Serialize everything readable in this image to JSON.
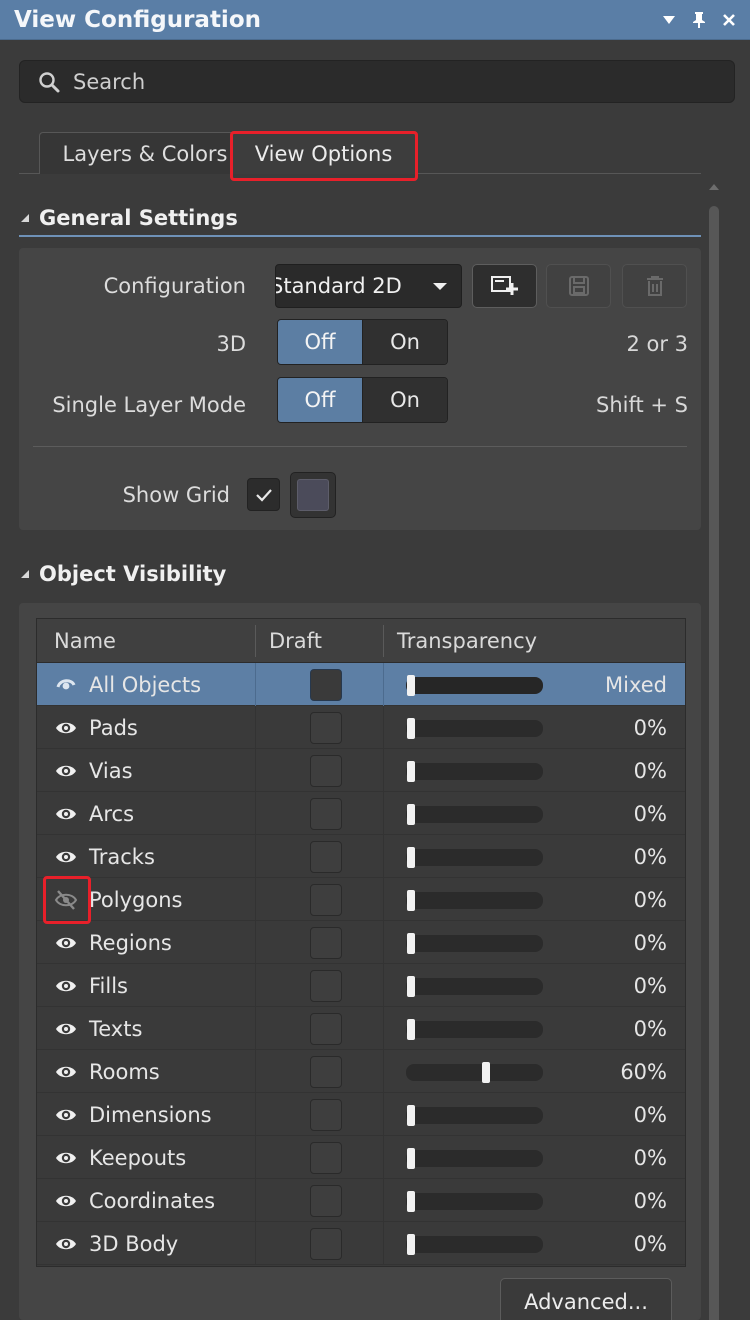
{
  "window": {
    "title": "View Configuration",
    "controls": [
      "▼",
      "⊥",
      "✕"
    ]
  },
  "search": {
    "placeholder": "Search"
  },
  "tabs": [
    {
      "label": "Layers & Colors",
      "active": false
    },
    {
      "label": "View Options",
      "active": true,
      "highlighted": true
    }
  ],
  "general": {
    "title": "General Settings",
    "configuration_label": "Configuration",
    "configuration_value": "Standard 2D",
    "three_d_label": "3D",
    "three_d_options": [
      "Off",
      "On"
    ],
    "three_d_selected": "Off",
    "three_d_shortcut": "2 or 3",
    "single_layer_label": "Single Layer Mode",
    "single_layer_options": [
      "Off",
      "On"
    ],
    "single_layer_selected": "Off",
    "single_layer_shortcut": "Shift + S",
    "show_grid_label": "Show Grid",
    "show_grid_checked": true
  },
  "objects": {
    "title": "Object Visibility",
    "columns": [
      "Name",
      "Draft",
      "Transparency"
    ],
    "rows": [
      {
        "name": "All Objects",
        "visible": "mixed",
        "value": "Mixed",
        "level": 0.0,
        "selected": true
      },
      {
        "name": "Pads",
        "visible": true,
        "value": "0%",
        "level": 0.0
      },
      {
        "name": "Vias",
        "visible": true,
        "value": "0%",
        "level": 0.0
      },
      {
        "name": "Arcs",
        "visible": true,
        "value": "0%",
        "level": 0.0
      },
      {
        "name": "Tracks",
        "visible": true,
        "value": "0%",
        "level": 0.0
      },
      {
        "name": "Polygons",
        "visible": false,
        "value": "0%",
        "level": 0.0,
        "highlighted": true
      },
      {
        "name": "Regions",
        "visible": true,
        "value": "0%",
        "level": 0.0
      },
      {
        "name": "Fills",
        "visible": true,
        "value": "0%",
        "level": 0.0
      },
      {
        "name": "Texts",
        "visible": true,
        "value": "0%",
        "level": 0.0
      },
      {
        "name": "Rooms",
        "visible": true,
        "value": "60%",
        "level": 0.6
      },
      {
        "name": "Dimensions",
        "visible": true,
        "value": "0%",
        "level": 0.0
      },
      {
        "name": "Keepouts",
        "visible": true,
        "value": "0%",
        "level": 0.0
      },
      {
        "name": "Coordinates",
        "visible": true,
        "value": "0%",
        "level": 0.0
      },
      {
        "name": "3D Body",
        "visible": true,
        "value": "0%",
        "level": 0.0
      }
    ],
    "advanced_label": "Advanced..."
  },
  "colors": {
    "title_bar": "#5a7ea6",
    "selection": "#5d7fa5",
    "highlight": "#e8202a",
    "background": "#3b3b3b"
  }
}
